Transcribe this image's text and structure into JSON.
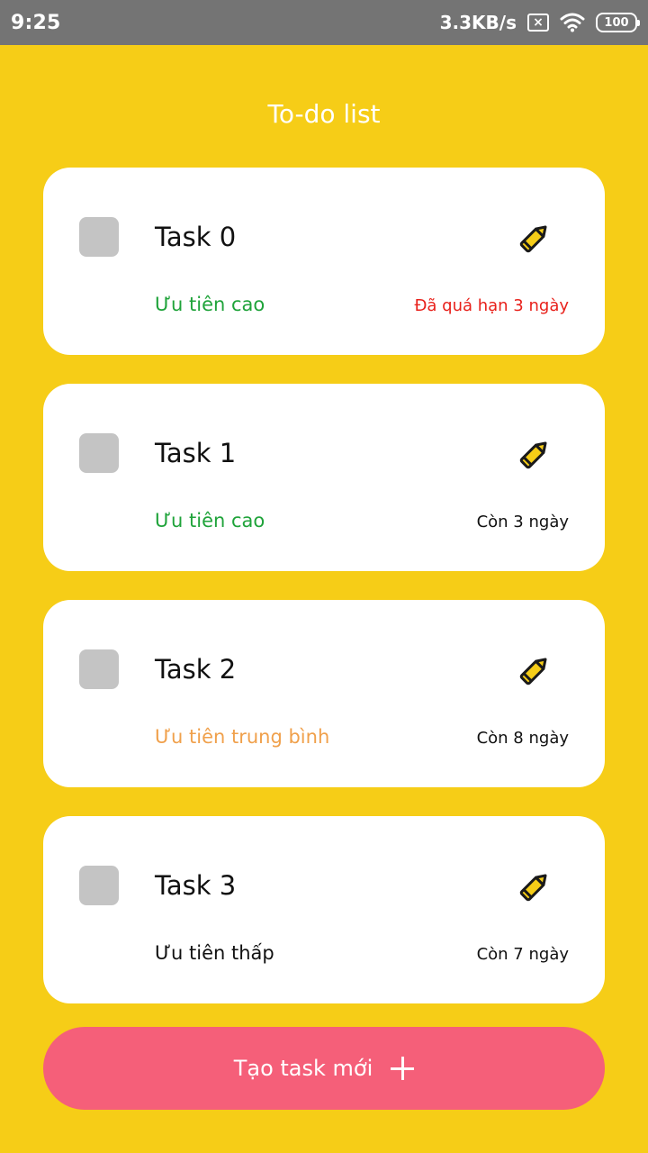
{
  "status_bar": {
    "time": "9:25",
    "speed": "3.3KB/s",
    "sim_icon": "sim-off-icon",
    "sim_symbol": "×",
    "wifi_icon": "wifi-icon",
    "battery": "100"
  },
  "app": {
    "title": "To-do list"
  },
  "colors": {
    "background": "#F6CD17",
    "priority_high": "#1FA33A",
    "priority_medium": "#F0A04B",
    "priority_low": "#111111",
    "overdue": "#E8211B",
    "button": "#F55F79",
    "checkbox": "#C4C4C4"
  },
  "tasks": [
    {
      "name": "Task 0",
      "priority": "Ưu tiên cao",
      "priority_level": "high",
      "due": "Đã quá hạn 3 ngày",
      "overdue": true
    },
    {
      "name": "Task 1",
      "priority": "Ưu tiên cao",
      "priority_level": "high",
      "due": "Còn 3 ngày",
      "overdue": false
    },
    {
      "name": "Task 2",
      "priority": "Ưu tiên trung bình",
      "priority_level": "medium",
      "due": "Còn 8 ngày",
      "overdue": false
    },
    {
      "name": "Task 3",
      "priority": "Ưu tiên thấp",
      "priority_level": "low",
      "due": "Còn 7 ngày",
      "overdue": false
    }
  ],
  "create_button": {
    "label": "Tạo task mới",
    "icon": "plus-icon"
  }
}
